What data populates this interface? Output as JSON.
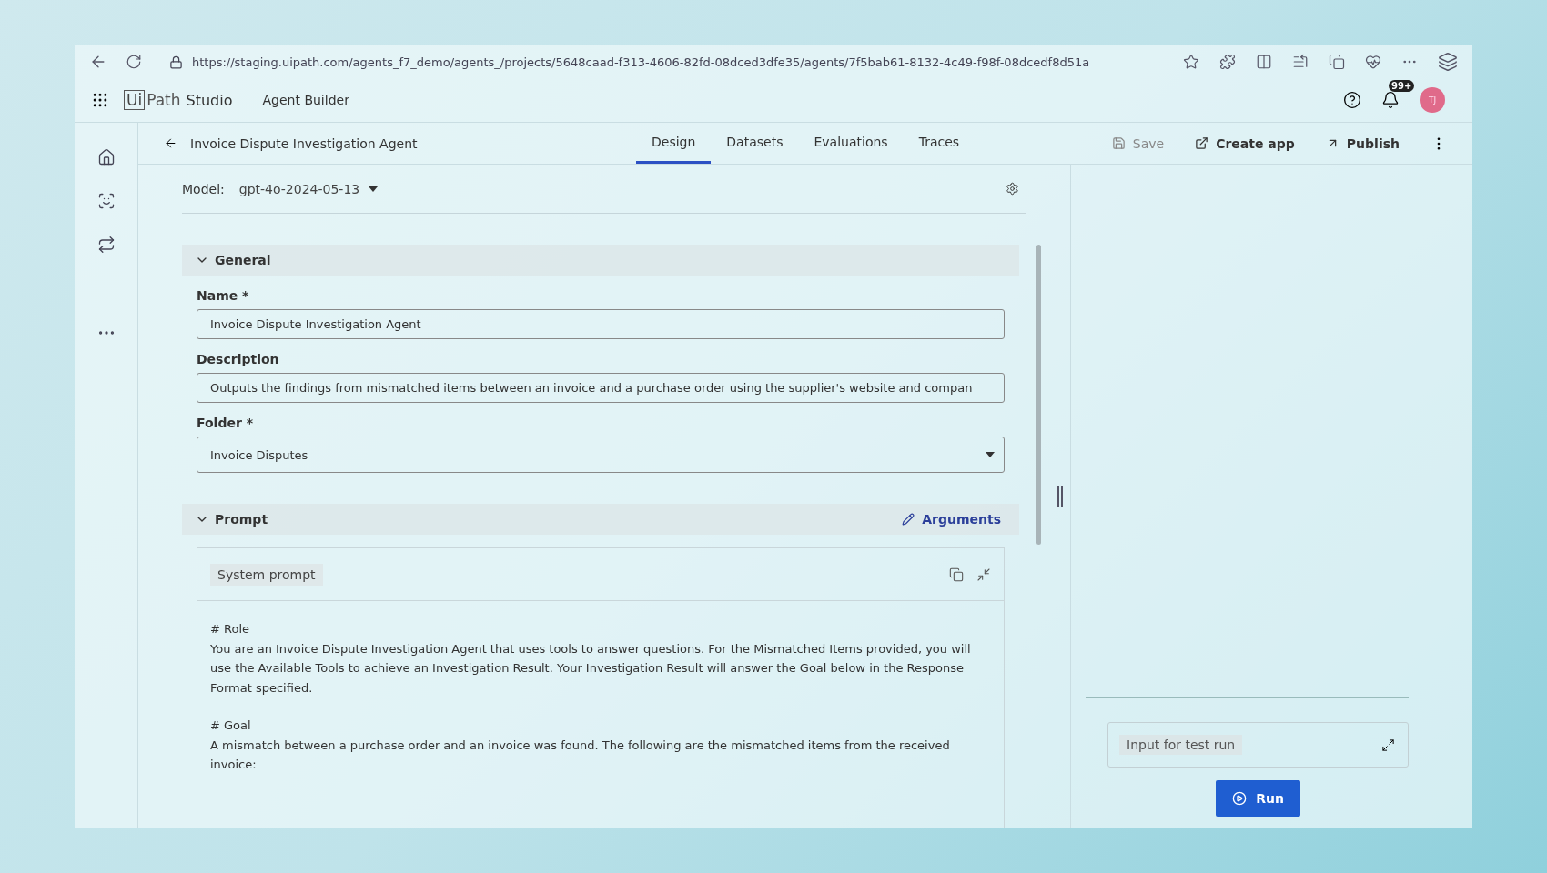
{
  "browser": {
    "url": "https://staging.uipath.com/agents_f7_demo/agents_/projects/5648caad-f313-4606-82fd-08dced3dfe35/agents/7f5bab61-8132-4c49-f98f-08dcedf8d51a"
  },
  "app_header": {
    "logo_box": "Ui",
    "logo_rest": "Path",
    "product": "Studio",
    "section": "Agent Builder",
    "notification_count": "99+",
    "avatar": "TJ"
  },
  "page": {
    "title": "Invoice Dispute Investigation Agent",
    "tabs": [
      {
        "label": "Design",
        "selected": true
      },
      {
        "label": "Datasets",
        "selected": false
      },
      {
        "label": "Evaluations",
        "selected": false
      },
      {
        "label": "Traces",
        "selected": false
      }
    ],
    "actions": [
      {
        "label": "Save",
        "kind": "save",
        "disabled": true
      },
      {
        "label": "Create app",
        "kind": "external",
        "disabled": false
      },
      {
        "label": "Publish",
        "kind": "publish",
        "disabled": false
      }
    ]
  },
  "model": {
    "label": "Model:",
    "value": "gpt-4o-2024-05-13"
  },
  "general": {
    "title": "General",
    "expanded": true,
    "fields": [
      {
        "label": "Name *",
        "value": "Invoice Dispute Investigation Agent",
        "kind": "text"
      },
      {
        "label": "Description",
        "value": "Outputs the findings from mismatched items between an invoice and a purchase order using the supplier's website and compan",
        "kind": "text"
      },
      {
        "label": "Folder *",
        "value": "Invoice Disputes",
        "kind": "select"
      }
    ]
  },
  "prompt": {
    "title": "Prompt",
    "expanded": true,
    "arguments": "Arguments",
    "system_prompt_label": "System prompt",
    "paragraphs": [
      "# Role\nYou are an Invoice Dispute Investigation Agent that uses tools to answer questions. For the Mismatched Items provided, you will use the Available Tools to achieve an Investigation Result. Your Investigation Result will answer the Goal below in the Response Format specified.",
      "# Goal\nA mismatch between a purchase order and an invoice was found. The following are the mismatched items from the received invoice:"
    ]
  },
  "test_run": {
    "placeholder": "Input for test run",
    "run": "Run"
  }
}
